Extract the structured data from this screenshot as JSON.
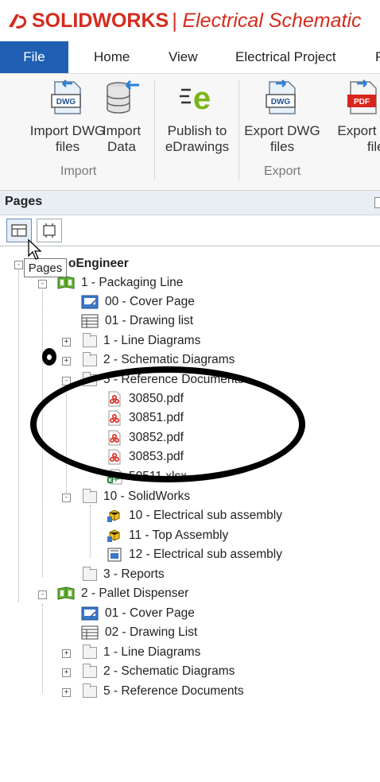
{
  "app": {
    "brand_bold": "SOLIDWORKS",
    "title_separator": "|",
    "product": "Electrical Schematic",
    "brand_color": "#d52b1e"
  },
  "menu": {
    "items": [
      "File",
      "Home",
      "View",
      "Electrical Project",
      "P"
    ],
    "active": "File",
    "active_color": "#1f5fb3"
  },
  "ribbon": {
    "groups": [
      {
        "label": "Import",
        "buttons": [
          {
            "line1": "Import DWG",
            "line2": "files",
            "icon": "import-dwg-icon"
          },
          {
            "line1": "Import",
            "line2": "Data",
            "icon": "import-data-icon"
          }
        ]
      },
      {
        "label": "",
        "buttons": [
          {
            "line1": "Publish to",
            "line2": "eDrawings",
            "icon": "edrawings-icon"
          }
        ]
      },
      {
        "label": "Export",
        "buttons": [
          {
            "line1": "Export DWG",
            "line2": "files",
            "icon": "export-dwg-icon"
          },
          {
            "line1": "Export P",
            "line2": "files",
            "icon": "export-pdf-icon"
          }
        ]
      }
    ],
    "icon_text": {
      "dwg": "DWG",
      "pdf": "PDF",
      "edrawings": "e"
    }
  },
  "pages_panel": {
    "title": "Pages",
    "tooltip": "Pages"
  },
  "tree": {
    "root": "oEngineer",
    "books": [
      {
        "label": "1 - Packaging Line",
        "children": [
          {
            "label": "00 - Cover Page",
            "icon": "cover-page-icon"
          },
          {
            "label": "01 - Drawing list",
            "icon": "drawing-list-icon"
          },
          {
            "label": "1 - Line Diagrams",
            "icon": "folder-icon"
          },
          {
            "label": "2 - Schematic Diagrams",
            "icon": "folder-icon"
          },
          {
            "label": "5 - Reference Documents",
            "icon": "folder-icon"
          },
          {
            "label": "30850.pdf",
            "icon": "pdf-file-icon"
          },
          {
            "label": "30851.pdf",
            "icon": "pdf-file-icon"
          },
          {
            "label": "30852.pdf",
            "icon": "pdf-file-icon"
          },
          {
            "label": "30853.pdf",
            "icon": "pdf-file-icon"
          },
          {
            "label": "50511.xlsx",
            "icon": "excel-file-icon"
          },
          {
            "label": "10 - SolidWorks",
            "icon": "folder-icon"
          },
          {
            "label": "10 - Electrical sub assembly",
            "icon": "assembly-icon"
          },
          {
            "label": "11 - Top Assembly",
            "icon": "assembly-icon"
          },
          {
            "label": "12 - Electrical sub assembly",
            "icon": "sub-assembly-icon"
          },
          {
            "label": "3 - Reports",
            "icon": "folder-icon"
          }
        ]
      },
      {
        "label": "2 - Pallet Dispenser",
        "children": [
          {
            "label": "01 - Cover Page",
            "icon": "cover-page-icon"
          },
          {
            "label": "02 - Drawing List",
            "icon": "drawing-list-icon"
          },
          {
            "label": "1 - Line Diagrams",
            "icon": "folder-icon"
          },
          {
            "label": "2 - Schematic Diagrams",
            "icon": "folder-icon"
          },
          {
            "label": "5 - Reference Documents",
            "icon": "folder-icon"
          }
        ]
      }
    ],
    "expander": {
      "collapsed": "+",
      "expanded": "-"
    }
  },
  "annotation": {
    "marker": "o"
  }
}
